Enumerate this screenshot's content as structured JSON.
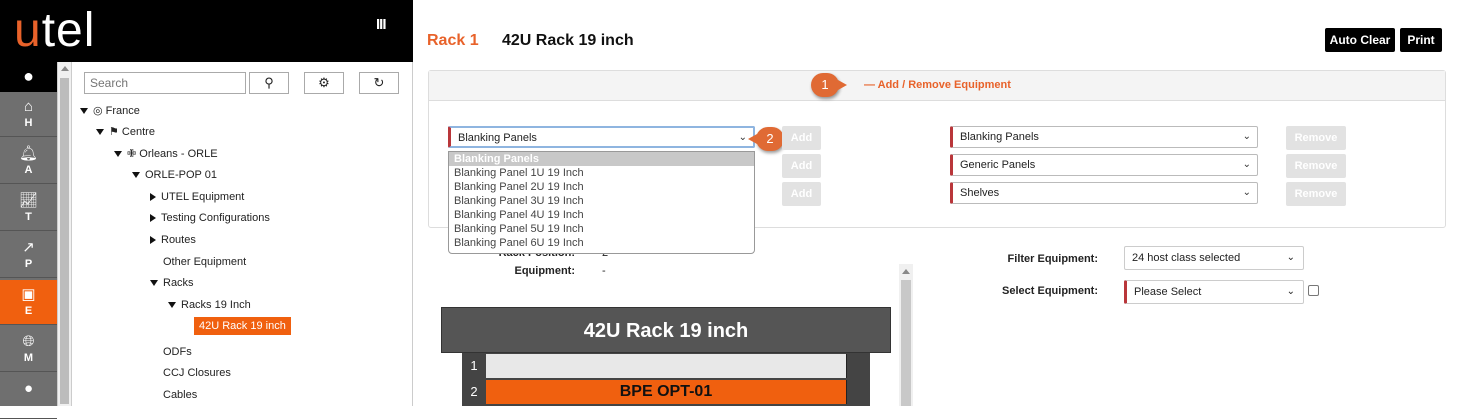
{
  "brand": {
    "logo_u": "u",
    "logo_rest": "tel",
    "menu_icon": "III"
  },
  "rail": {
    "items": [
      {
        "icon": "home-icon",
        "glyph": "⌂",
        "label": "H"
      },
      {
        "icon": "bell-icon",
        "glyph": "🔔︎",
        "label": "A"
      },
      {
        "icon": "chart-icon",
        "glyph": "📈︎",
        "label": "T"
      },
      {
        "icon": "share-icon",
        "glyph": "↗",
        "label": "P"
      },
      {
        "icon": "chip-icon",
        "glyph": "▣",
        "label": "E",
        "active": true
      },
      {
        "icon": "globe-icon",
        "glyph": "🌐︎",
        "label": "M"
      },
      {
        "icon": "pin-icon",
        "glyph": "●",
        "label": ""
      }
    ]
  },
  "search": {
    "placeholder": "Search"
  },
  "tree": {
    "nodes": [
      {
        "label": "France",
        "icon": "globe"
      },
      {
        "label": "Centre",
        "icon": "flag"
      },
      {
        "label": "Orleans - ORLE",
        "icon": "pin"
      },
      {
        "label": "ORLE-POP 01"
      },
      {
        "label": "UTEL Equipment"
      },
      {
        "label": "Testing Configurations"
      },
      {
        "label": "Routes"
      },
      {
        "label": "Other Equipment"
      },
      {
        "label": "Racks"
      },
      {
        "label": "Racks 19 Inch"
      },
      {
        "label": "42U Rack 19 inch"
      },
      {
        "label": "ODFs"
      },
      {
        "label": "CCJ Closures"
      },
      {
        "label": "Cables"
      }
    ]
  },
  "header": {
    "rack_label": "Rack 1",
    "rack_name": "42U Rack 19 inch",
    "auto_clear": "Auto Clear",
    "print": "Print"
  },
  "equip_panel": {
    "toggle": "— Add / Remove Equipment",
    "callout1": "1",
    "callout2": "2",
    "left_select": "Blanking Panels",
    "add_label": "Add",
    "remove_label": "Remove",
    "right_selects": [
      "Blanking Panels",
      "Generic Panels",
      "Shelves"
    ],
    "dropdown_options": [
      "Blanking Panels",
      "Blanking Panel 1U 19 Inch",
      "Blanking Panel 2U 19 Inch",
      "Blanking Panel 3U 19 Inch",
      "Blanking Panel 4U 19 Inch",
      "Blanking Panel 5U 19 Inch",
      "Blanking Panel 6U 19 Inch"
    ]
  },
  "info": {
    "rack_position_label": "Rack Position:",
    "rack_position_value": "2",
    "equipment_label": "Equipment:",
    "equipment_value": "-"
  },
  "rack": {
    "title": "42U Rack 19 inch",
    "slots": [
      {
        "num": "1",
        "label": "",
        "color": "#e8e8e8"
      },
      {
        "num": "2",
        "label": "BPE OPT-01",
        "color": "#f0600f"
      }
    ]
  },
  "filter": {
    "filter_label": "Filter Equipment:",
    "filter_value": "24 host class selected",
    "select_label": "Select Equipment:",
    "select_value": "Please Select"
  },
  "colors": {
    "accent": "#f0600f",
    "required": "#b9363a"
  }
}
